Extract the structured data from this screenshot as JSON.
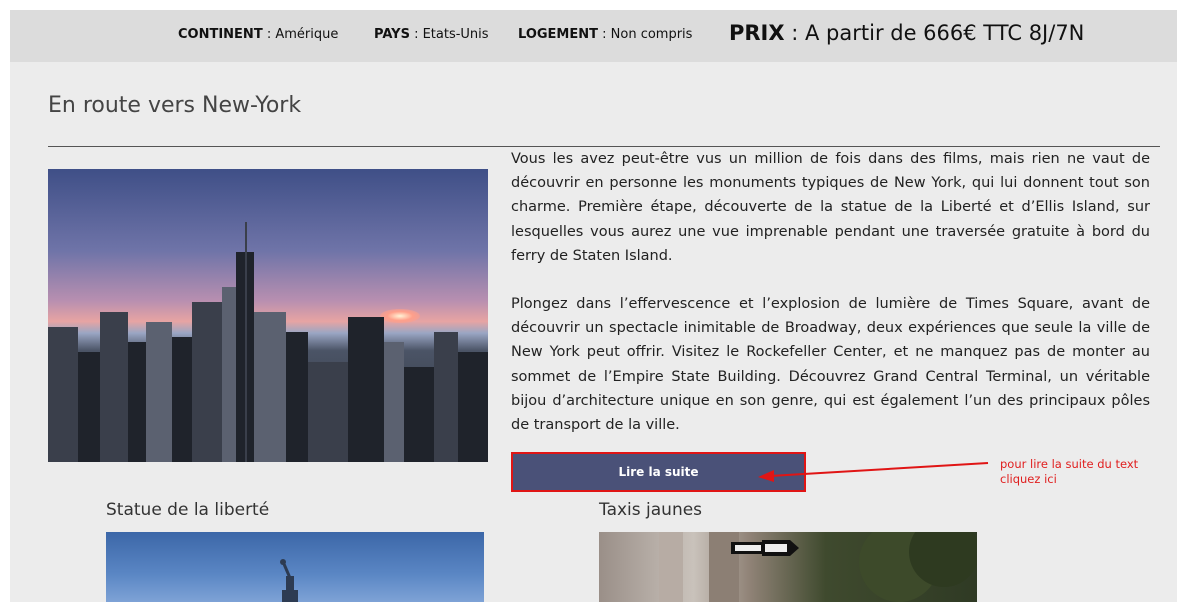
{
  "info_bar": {
    "continent_label": "CONTINENT",
    "continent_value": " : Amérique",
    "pays_label": "PAYS",
    "pays_value": " : Etats-Unis",
    "logement_label": "LOGEMENT",
    "logement_value": " : Non compris",
    "prix_label": "PRIX",
    "prix_value": " : A partir de 666€ TTC 8J/7N"
  },
  "main": {
    "title": "En route vers New-York",
    "paragraph_1": "Vous les avez peut-être vus un million de fois dans des films, mais rien ne vaut de découvrir en personne les monuments typiques de New York, qui lui donnent tout son charme. Première étape, découverte de la statue de la Liberté et d’Ellis Island, sur lesquelles vous aurez une vue imprenable pendant une traversée gratuite à bord du ferry de Staten Island.",
    "paragraph_2": "Plongez dans l’effervescence et l’explosion de lumière de Times Square, avant de découvrir un spectacle inimitable de Broadway, deux expériences que seule la ville de New York peut offrir. Visitez le Rockefeller Center, et ne manquez pas de monter au sommet de l’Empire State Building. Découvrez Grand Central Terminal, un véritable bijou d’architecture unique en son genre, qui est également l’un des principaux pôles de transport de la ville.",
    "read_more_label": "Lire la suite"
  },
  "annotation": {
    "text": "pour lire la suite du text cliquez ici",
    "color": "#e02020"
  },
  "cards": [
    {
      "title": "Statue de la liberté"
    },
    {
      "title": "Taxis jaunes"
    }
  ],
  "colors": {
    "button_bg": "#4a5178",
    "highlight_border": "#e01515",
    "info_bar_bg": "#dcdcdc",
    "page_bg": "#ececec"
  }
}
